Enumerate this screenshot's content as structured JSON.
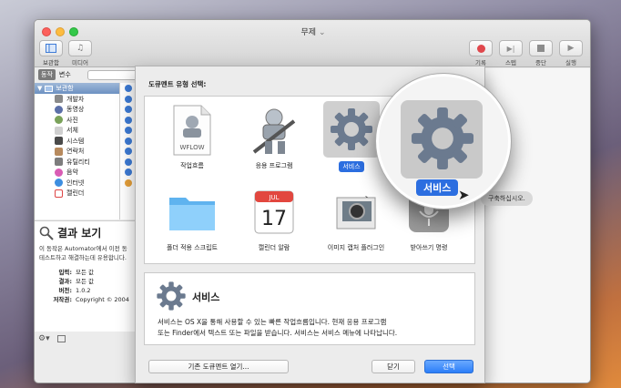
{
  "window": {
    "title": "무제"
  },
  "toolbar": {
    "library_label": "보관함",
    "media_label": "미디어",
    "record_label": "기록",
    "step_label": "스텝",
    "stop_label": "중단",
    "run_label": "실행"
  },
  "left_tabs": {
    "actions": "동작",
    "variables": "변수"
  },
  "library": {
    "header": "보관함",
    "items": [
      {
        "label": "개발자",
        "icon": "hammer-icon"
      },
      {
        "label": "동영상",
        "icon": "film-icon"
      },
      {
        "label": "사진",
        "icon": "photo-icon"
      },
      {
        "label": "서체",
        "icon": "font-icon"
      },
      {
        "label": "시스템",
        "icon": "system-icon"
      },
      {
        "label": "연락처",
        "icon": "contacts-icon"
      },
      {
        "label": "유틸리티",
        "icon": "utility-icon"
      },
      {
        "label": "음악",
        "icon": "music-icon"
      },
      {
        "label": "인터넷",
        "icon": "globe-icon"
      },
      {
        "label": "캘린더",
        "icon": "calendar-icon"
      }
    ]
  },
  "description": {
    "title": "결과 보기",
    "text_line1": "이 동작은 Automator에서 이전 동",
    "text_line2": "테스트하고 해결하는데 유용합니다.",
    "meta": [
      {
        "key": "입력:",
        "value": "모든 값"
      },
      {
        "key": "결과:",
        "value": "모든 값"
      },
      {
        "key": "버전:",
        "value": "1.0.2"
      },
      {
        "key": "저작권:",
        "value": "Copyright © 2004"
      }
    ]
  },
  "sheet": {
    "title": "도큐멘트 유형 선택:",
    "doc_types": [
      {
        "label": "작업흐름",
        "icon": "workflow-icon"
      },
      {
        "label": "응용 프로그램",
        "icon": "application-icon"
      },
      {
        "label": "서비스",
        "icon": "gear-icon",
        "selected": true
      },
      {
        "label": "폴더 적용 스크립트",
        "icon": "folder-icon"
      },
      {
        "label": "캘린더 알람",
        "icon": "calendar-icon"
      },
      {
        "label": "이미지 캡처 플러그인",
        "icon": "camera-icon"
      },
      {
        "label": "받아쓰기 명령",
        "icon": "microphone-icon"
      }
    ],
    "workflow_icon_text": "WFLOW",
    "calendar_month": "JUL",
    "calendar_day": "17",
    "info_title": "서비스",
    "info_line1": "서비스는 OS X을 통해 사용할 수 있는 빠른 작업흐름입니다. 현재 응용 프로그램",
    "info_line2": "또는 Finder에서 텍스트 또는 파일을 받습니다. 서비스는 서비스 메뉴에 나타납니다.",
    "open_existing": "기존 도큐멘트 열기...",
    "close": "닫기",
    "choose": "선택"
  },
  "magnifier": {
    "label": "서비스"
  },
  "tooltip": {
    "text": "구축하십시오."
  },
  "colors": {
    "accent": "#2c6ee0",
    "record": "#e0474c"
  }
}
